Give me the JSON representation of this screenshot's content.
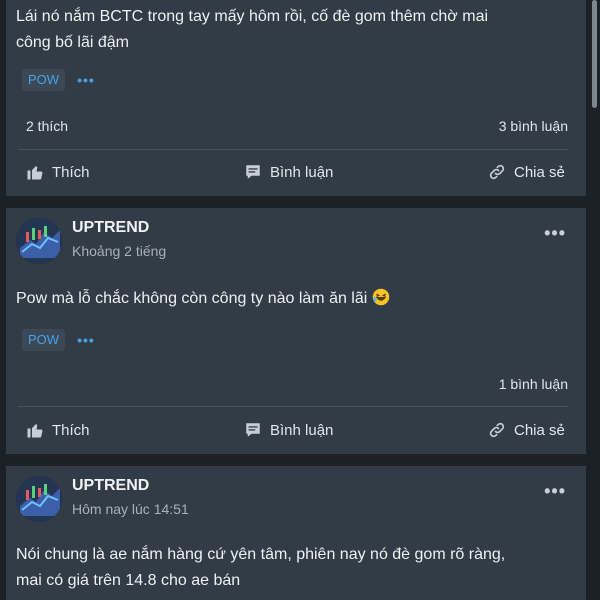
{
  "posts": [
    {
      "text_line1": "Lái nó nắm BCTC trong tay mấy hôm rồi, cố đè gom thêm chờ mai",
      "text_line2": "công bố lãi đậm",
      "tag": "POW",
      "more": "•••",
      "likes": "2 thích",
      "comments": "3 bình luận",
      "actions": {
        "like": "Thích",
        "comment": "Bình luận",
        "share": "Chia sẻ"
      }
    },
    {
      "author": "UPTREND",
      "time": "Khoảng 2 tiếng",
      "text": "Pow mà lỗ chắc không còn công ty nào làm ăn lãi",
      "tag": "POW",
      "more": "•••",
      "comments": "1 bình luận",
      "menu": "•••",
      "actions": {
        "like": "Thích",
        "comment": "Bình luận",
        "share": "Chia sẻ"
      }
    },
    {
      "author": "UPTREND",
      "time": "Hôm nay lúc 14:51",
      "text_line1": "Nói chung là ae nắm hàng cứ yên tâm, phiên nay nó đè gom rõ ràng,",
      "text_line2": "mai có giá trên 14.8 cho ae bán",
      "menu": "•••"
    }
  ],
  "colors": {
    "page_bg": "#1c2128",
    "card_bg": "#323c47",
    "tag_text": "#4aa1e8",
    "tag_bg": "#3b4856"
  },
  "icons": [
    "thumbs-up-icon",
    "comment-icon",
    "share-link-icon",
    "more-icon",
    "laughing-emoji-icon"
  ]
}
